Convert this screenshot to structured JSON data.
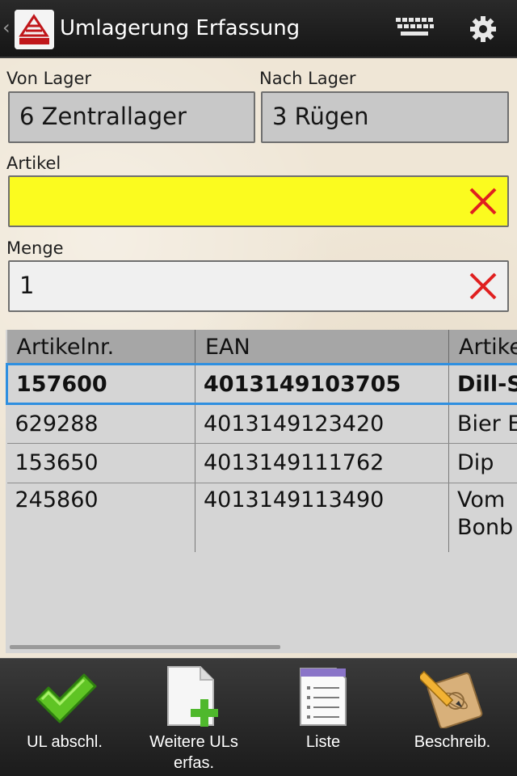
{
  "app": {
    "title": "Umlagerung Erfassung",
    "up_glyph": "‹",
    "icons": {
      "keyboard": "keyboard-icon",
      "settings": "gear-icon",
      "logo": "app-logo"
    }
  },
  "form": {
    "von_lager_label": "Von Lager",
    "von_lager_value": "6 Zentrallager",
    "nach_lager_label": "Nach Lager",
    "nach_lager_value": "3 Rügen",
    "artikel_label": "Artikel",
    "artikel_value": "",
    "menge_label": "Menge",
    "menge_value": "1",
    "colors": {
      "artikel_bg": "#fbfb1f",
      "clear_x": "#e02020"
    }
  },
  "table": {
    "columns": [
      "Artikelnr.",
      "EAN",
      "Artike"
    ],
    "rows": [
      {
        "artnr": "157600",
        "ean": "4013149103705",
        "artikel": "Dill-S",
        "selected": true
      },
      {
        "artnr": "629288",
        "ean": "4013149123420",
        "artikel": "Bier E"
      },
      {
        "artnr": "153650",
        "ean": "4013149111762",
        "artikel": "Dip"
      },
      {
        "artnr": "245860",
        "ean": "4013149113490",
        "artikel": "Vom",
        "artikel2": "Bonb"
      }
    ],
    "selection_color": "#2e8fe0"
  },
  "bottom_bar": {
    "buttons": [
      {
        "label": "UL abschl.",
        "icon": "checkmark-icon"
      },
      {
        "label": "Weitere ULs erfas.",
        "icon": "new-document-plus-icon"
      },
      {
        "label": "Liste",
        "icon": "list-document-icon"
      },
      {
        "label": "Beschreib.",
        "icon": "notebook-pencil-icon"
      }
    ]
  }
}
